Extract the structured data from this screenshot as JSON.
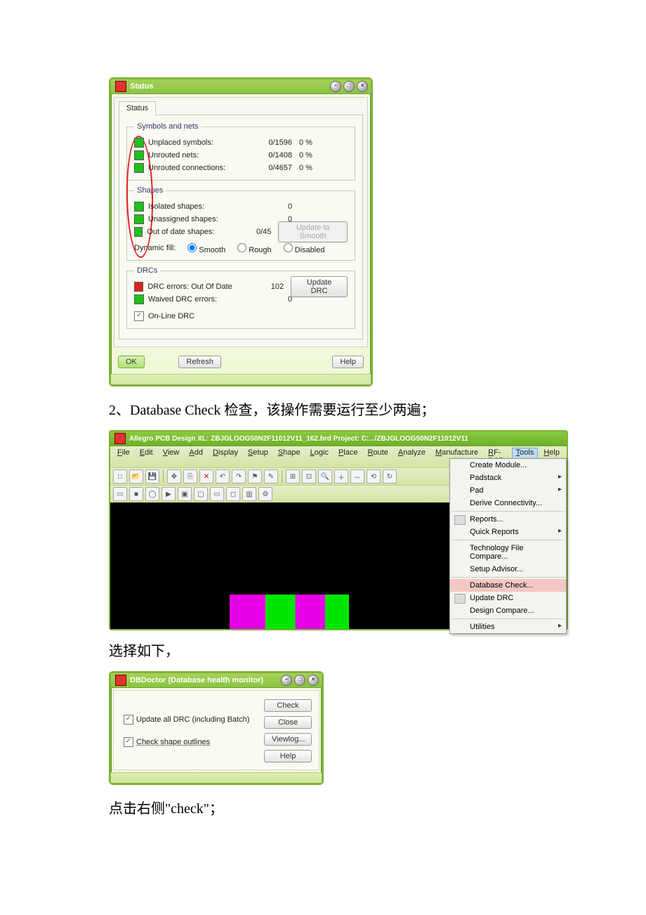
{
  "status_dialog": {
    "title": "Status",
    "tab": "Status",
    "groups": {
      "symbols_nets": {
        "legend": "Symbols and nets",
        "rows": [
          {
            "color": "green",
            "label": "Unplaced symbols:",
            "value": "0/1596",
            "pct": "0 %"
          },
          {
            "color": "green",
            "label": "Unrouted nets:",
            "value": "0/1408",
            "pct": "0 %"
          },
          {
            "color": "green",
            "label": "Unrouted connections:",
            "value": "0/4657",
            "pct": "0 %"
          }
        ]
      },
      "shapes": {
        "legend": "Shapes",
        "rows": [
          {
            "color": "green",
            "label": "Isolated shapes:",
            "value": "0",
            "pct": ""
          },
          {
            "color": "green",
            "label": "Unassigned shapes:",
            "value": "0",
            "pct": ""
          },
          {
            "color": "green",
            "label": "Out of date shapes:",
            "value": "0/45",
            "pct": ""
          }
        ],
        "update_btn": "Update to Smooth",
        "dynamic_label": "Dynamic fill:",
        "radios": {
          "smooth": "Smooth",
          "rough": "Rough",
          "disabled": "Disabled"
        }
      },
      "drcs": {
        "legend": "DRCs",
        "rows": [
          {
            "color": "red",
            "label": "DRC errors:   Out Of Date",
            "value": "102"
          },
          {
            "color": "green",
            "label": "Waived DRC errors:",
            "value": "0"
          }
        ],
        "update_btn": "Update DRC",
        "online_label": "On-Line DRC"
      }
    },
    "buttons": {
      "ok": "OK",
      "refresh": "Refresh",
      "help": "Help"
    }
  },
  "doc": {
    "line1": "2、Database Check 检查，该操作需要运行至少两遍；",
    "line2": "选择如下，",
    "line3": "点击右侧\"check\"；"
  },
  "allegro": {
    "title": "Allegro PCB Design XL: ZBJGLOOG50N2F11012V11_162.brd  Project: C:.../ZBJGLOOG50N2F11012V11",
    "menus": [
      "File",
      "Edit",
      "View",
      "Add",
      "Display",
      "Setup",
      "Shape",
      "Logic",
      "Place",
      "Route",
      "Analyze",
      "Manufacture",
      "RF-PCB",
      "Tools",
      "Help"
    ],
    "tools_menu": [
      {
        "label": "Create Module...",
        "sep": false
      },
      {
        "label": "Padstack",
        "arrow": true
      },
      {
        "label": "Pad",
        "arrow": true
      },
      {
        "label": "Derive Connectivity...",
        "sep_after": true
      },
      {
        "label": "Reports...",
        "icon": true
      },
      {
        "label": "Quick Reports",
        "arrow": true,
        "sep_after": true
      },
      {
        "label": "Technology File Compare..."
      },
      {
        "label": "Setup Advisor...",
        "sep_after": true
      },
      {
        "label": "Database Check...",
        "hl": true
      },
      {
        "label": "Update DRC",
        "icon": true
      },
      {
        "label": "Design Compare...",
        "sep_after": true
      },
      {
        "label": "Utilities",
        "arrow": true
      }
    ]
  },
  "dbdoctor": {
    "title": "DBDoctor (Database health monitor)",
    "opt1": "Update all DRC (including Batch)",
    "opt2": "Check shape outlines",
    "buttons": {
      "check": "Check",
      "close": "Close",
      "viewlog": "Viewlog...",
      "help": "Help"
    }
  }
}
